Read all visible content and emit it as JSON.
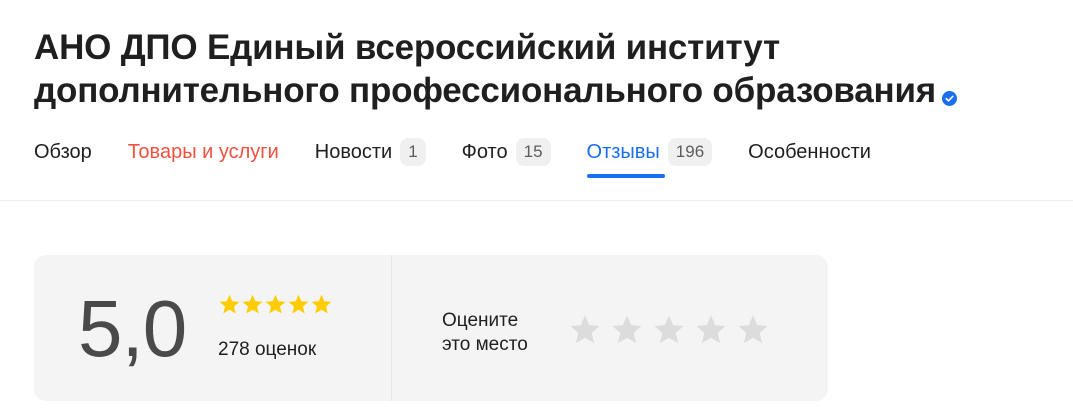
{
  "org": {
    "title_line1": "АНО ДПО Единый всероссийский институт",
    "title_line2": "дополнительного профессионального образования",
    "verified_icon": "verified-check-icon"
  },
  "tabs": [
    {
      "label": "Обзор"
    },
    {
      "label": "Товары и услуги"
    },
    {
      "label": "Новости",
      "count": "1"
    },
    {
      "label": "Фото",
      "count": "15"
    },
    {
      "label": "Отзывы",
      "count": "196"
    },
    {
      "label": "Особенности"
    }
  ],
  "colors": {
    "active_tab": "#1a6ef0",
    "highlight_tab": "#f1513e",
    "star_filled": "#ffcc00",
    "star_empty": "#dcdcdc"
  },
  "rating": {
    "score": "5,0",
    "stars_filled": 5,
    "stars_total": 5,
    "votes_text": "278 оценок"
  },
  "rate_place": {
    "line1": "Оцените",
    "line2": "это место",
    "stars_total": 5
  }
}
